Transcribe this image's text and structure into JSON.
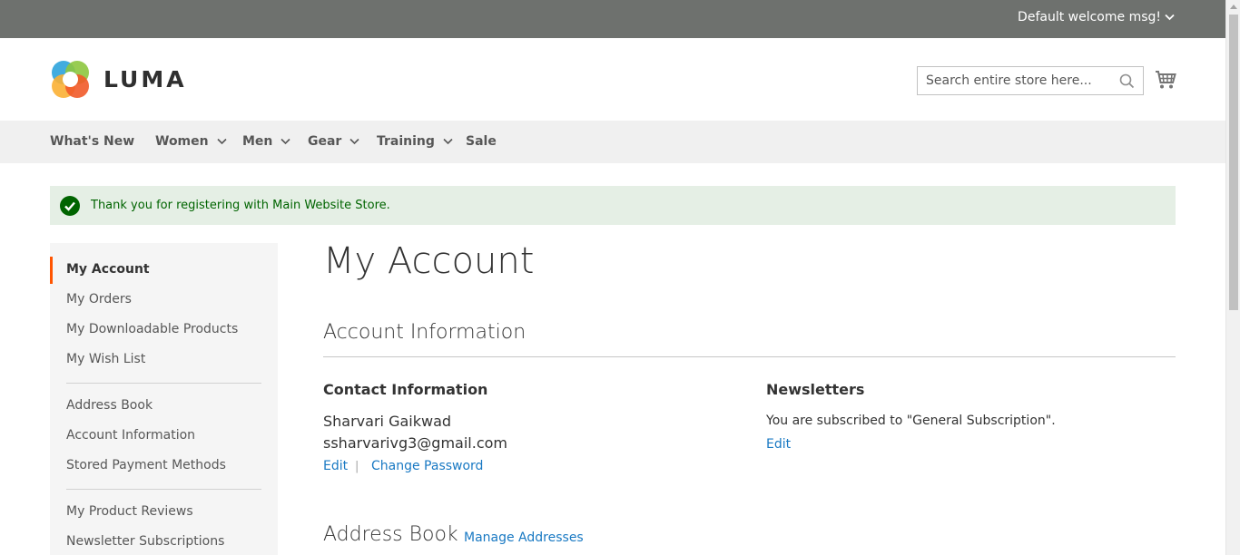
{
  "header": {
    "welcome": "Default welcome msg!",
    "logo_text": "LUMA",
    "search_placeholder": "Search entire store here...",
    "colors": {
      "topbar": "#6e716e",
      "nav_bg": "#f0f0f0",
      "accent": "#ff5501",
      "link": "#1979c3",
      "success_bg": "#e5efe5",
      "success_text": "#006400"
    }
  },
  "nav": {
    "items": [
      {
        "label": "What's New",
        "dropdown": false
      },
      {
        "label": "Women",
        "dropdown": true
      },
      {
        "label": "Men",
        "dropdown": true
      },
      {
        "label": "Gear",
        "dropdown": true
      },
      {
        "label": "Training",
        "dropdown": true
      },
      {
        "label": "Sale",
        "dropdown": false
      }
    ]
  },
  "message": {
    "text": "Thank you for registering with Main Website Store.",
    "icon": "checkmark-icon"
  },
  "sidebar": {
    "current": "My Account",
    "group1": [
      "My Orders",
      "My Downloadable Products",
      "My Wish List"
    ],
    "group2": [
      "Address Book",
      "Account Information",
      "Stored Payment Methods"
    ],
    "group3": [
      "My Product Reviews",
      "Newsletter Subscriptions"
    ]
  },
  "main": {
    "page_title": "My Account",
    "account_info": {
      "title": "Account Information",
      "contact": {
        "title": "Contact Information",
        "name": "Sharvari Gaikwad",
        "email": "ssharvarivg3@gmail.com",
        "edit_label": "Edit",
        "separator": "|",
        "change_password_label": "Change Password"
      },
      "newsletters": {
        "title": "Newsletters",
        "text": "You are subscribed to \"General Subscription\".",
        "edit_label": "Edit"
      }
    },
    "address_book": {
      "title": "Address Book",
      "manage_label": "Manage Addresses"
    }
  }
}
